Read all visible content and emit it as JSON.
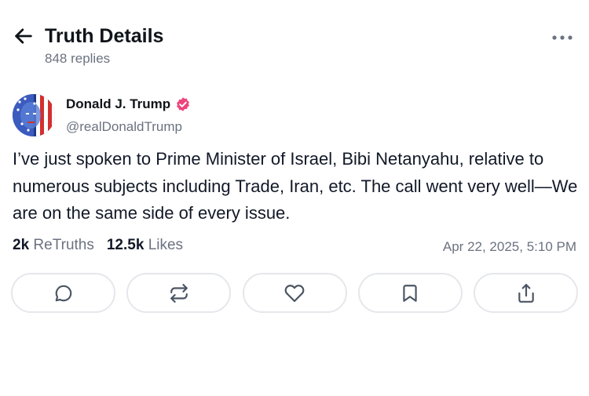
{
  "header": {
    "title": "Truth Details",
    "subtitle": "848 replies"
  },
  "post": {
    "author_name": "Donald J. Trump",
    "author_handle": "@realDonaldTrump",
    "text": "I’ve just spoken to Prime Minister of Israel, Bibi Netanyahu, relative to numerous subjects including Trade, Iran, etc. The call went very well—We are on the same side of every issue.",
    "retruths_count": "2k",
    "retruths_label": "ReTruths",
    "likes_count": "12.5k",
    "likes_label": "Likes",
    "timestamp": "Apr 22, 2025, 5:10 PM"
  },
  "icons": {
    "back": "arrow-left-icon",
    "more": "more-horizontal-icon",
    "verified": "verified-badge-icon",
    "reply": "reply-icon",
    "retruth": "retruth-icon",
    "like": "heart-icon",
    "bookmark": "bookmark-icon",
    "share": "share-icon"
  },
  "colors": {
    "verified_badge": "#f0447a",
    "muted_text": "#6b7280",
    "border": "#e5e7eb"
  }
}
